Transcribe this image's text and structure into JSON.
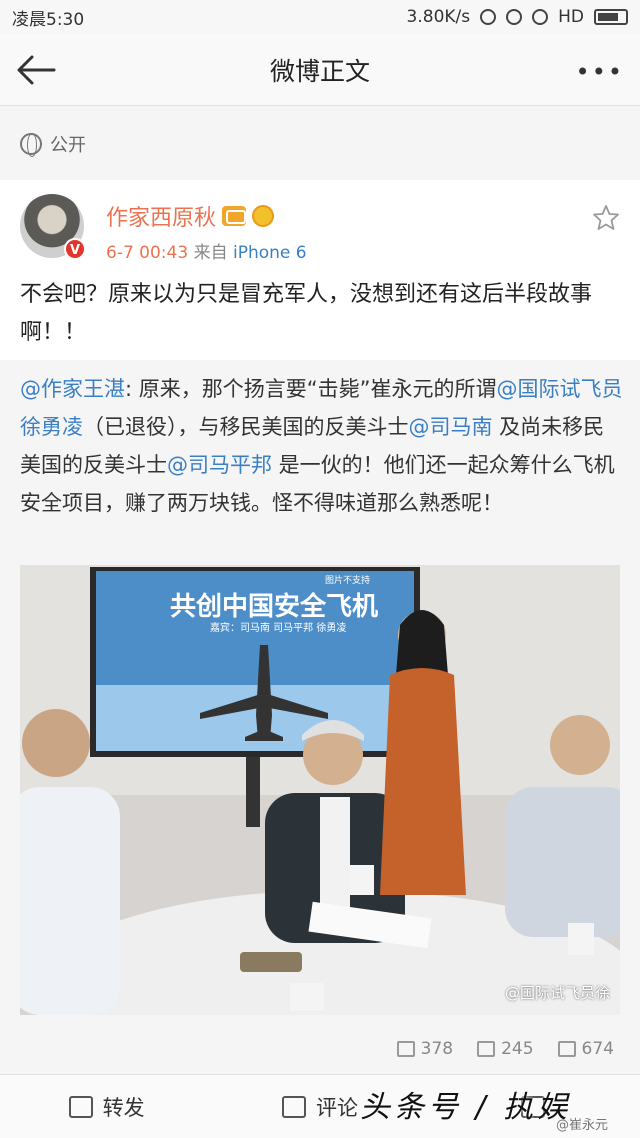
{
  "status_bar": {
    "time": "凌晨5:30",
    "network_speed": "3.80K/s",
    "network_type": "HD"
  },
  "nav": {
    "title": "微博正文",
    "more": "•••"
  },
  "visibility": {
    "label": "公开"
  },
  "post": {
    "author": "作家西原秋",
    "time": "6-7 00:43",
    "source_prefix": "来自",
    "source": "iPhone 6",
    "text": "不会吧？原来以为只是冒充军人，没想到还有这后半段故事啊！！"
  },
  "repost": {
    "author_mention": "@作家王湛",
    "part1": ": 原来，那个扬言要“击毙”崔永元的所谓",
    "mention2": "@国际试飞员徐勇凌",
    "part2": "（已退役），与移民美国的反美斗士",
    "mention3": "@司马南",
    "part3": " 及尚未移民美国的反美斗士",
    "mention4": "@司马平邦",
    "part4": " 是一伙的！他们还一起众筹什么飞机安全项目，赚了两万块钱。怪不得味道那么熟悉呢！",
    "image": {
      "screen_title": "共创中国安全飞机",
      "screen_tag": "图片不支持",
      "screen_sub": "嘉宾：司马南 司马平邦 徐勇凌",
      "watermark": "@国际试飞员徐"
    }
  },
  "counts": {
    "reposts": "378",
    "comments": "245",
    "likes": "674"
  },
  "toolbar": {
    "repost": "转发",
    "comment": "评论"
  },
  "overlay": {
    "watermark": "头条号 / 执娱",
    "watermark_small": "@崔永元"
  },
  "colors": {
    "author": "#eb7350",
    "mention": "#3a7fc4",
    "background": "#f5f5f5"
  }
}
